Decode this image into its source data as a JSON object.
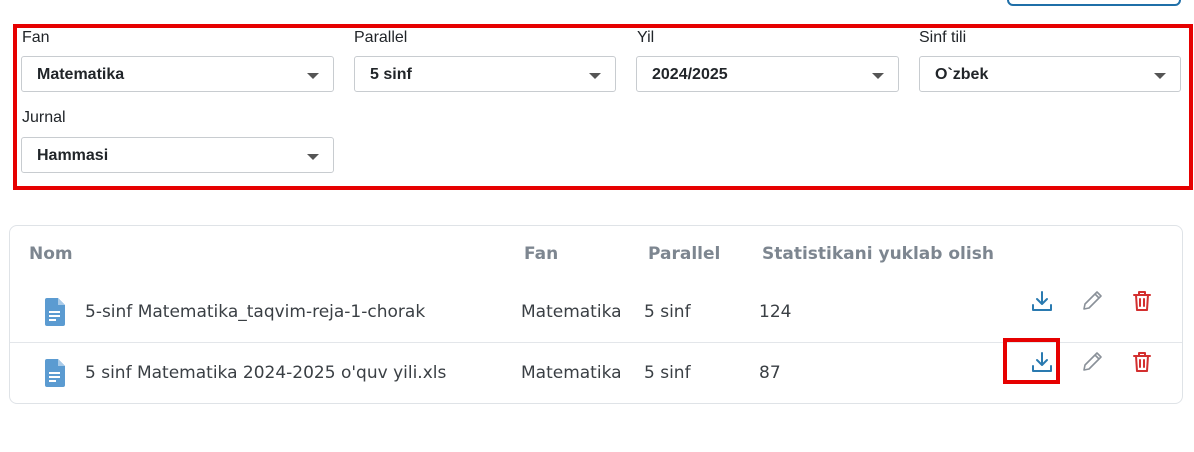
{
  "filters": {
    "fan": {
      "label": "Fan",
      "value": "Matematika"
    },
    "parallel": {
      "label": "Parallel",
      "value": "5 sinf"
    },
    "yil": {
      "label": "Yil",
      "value": "2024/2025"
    },
    "sinf_tili": {
      "label": "Sinf tili",
      "value": "O`zbek"
    },
    "jurnal": {
      "label": "Jurnal",
      "value": "Hammasi"
    }
  },
  "table": {
    "headers": {
      "nom": "Nom",
      "fan": "Fan",
      "parallel": "Parallel",
      "stat": "Statistikani yuklab olish"
    },
    "rows": [
      {
        "name": "5-sinf Matematika_taqvim-reja-1-chorak",
        "fan": "Matematika",
        "parallel": "5 sinf",
        "count": "124"
      },
      {
        "name": "5 sinf Matematika 2024-2025 o'quv yili.xls",
        "fan": "Matematika",
        "parallel": "5 sinf",
        "count": "87"
      }
    ]
  },
  "icons": {
    "file": "document-icon",
    "download": "download-icon",
    "edit": "pencil-icon",
    "delete": "trash-icon"
  },
  "colors": {
    "highlight": "#e60000",
    "download": "#2a7ab0",
    "delete": "#d32f2f",
    "edit": "#8a9199",
    "file_icon": "#5b9bd1"
  }
}
